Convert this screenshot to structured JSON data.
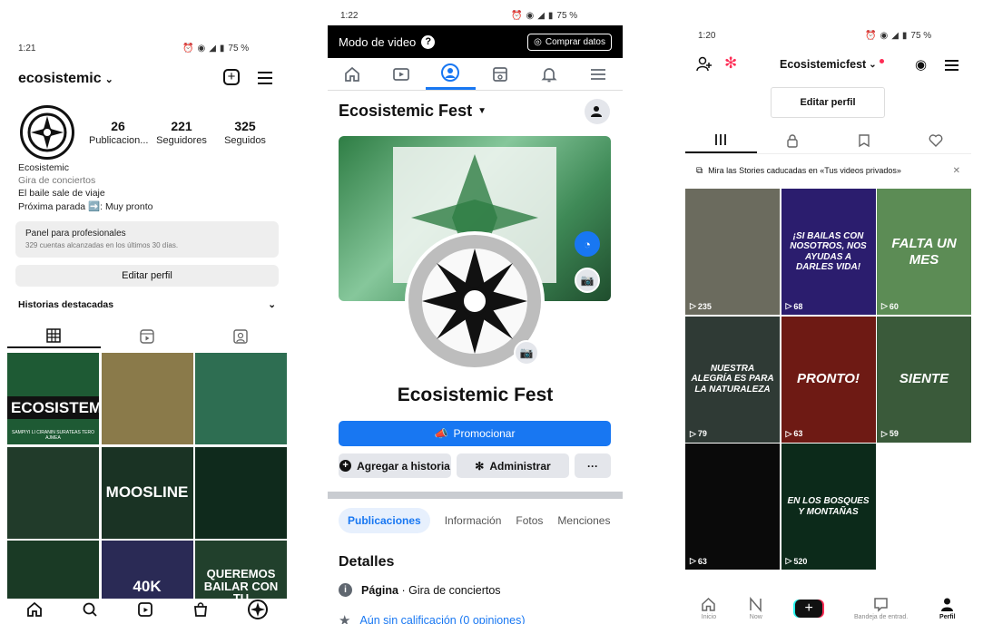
{
  "instagram": {
    "time": "1:21",
    "battery": "75 %",
    "username": "ecosistemic",
    "stats": [
      {
        "num": "26",
        "label": "Publicacion..."
      },
      {
        "num": "221",
        "label": "Seguidores"
      },
      {
        "num": "325",
        "label": "Seguidos"
      }
    ],
    "bio": {
      "name": "Ecosistemic",
      "category": "Gira de conciertos",
      "line1": "El baile sale de viaje",
      "line2": "Próxima parada ➡️: Muy pronto"
    },
    "panel": {
      "title": "Panel para profesionales",
      "subtitle": "329 cuentas alcanzadas en los últimos 30 días."
    },
    "edit_label": "Editar perfil",
    "highlights_label": "Historias destacadas",
    "grid": [
      {
        "text": "ECOSISTEMIC",
        "sub": "SAMPIYI LI CIRANIN SURATEAS TERO AJMEA",
        "bg": "#1e5a34"
      },
      {
        "text": "",
        "sub": "",
        "bg": "#8a7a4a"
      },
      {
        "text": "",
        "sub": "",
        "bg": "#2e6e52"
      },
      {
        "text": "",
        "sub": "",
        "bg": "#213b2a"
      },
      {
        "text": "MOOSLINE",
        "sub": "",
        "bg": "#1a3324"
      },
      {
        "text": "",
        "sub": "",
        "bg": "#0f2a1c"
      },
      {
        "text": "",
        "sub": "",
        "bg": "#1a3a25"
      },
      {
        "text": "40K",
        "sub": "",
        "bg": "#2a2a55"
      },
      {
        "text": "QUEREMOS BAILAR CON TU",
        "sub": "",
        "bg": "#21402c"
      }
    ]
  },
  "facebook": {
    "time": "1:22",
    "battery": "75 %",
    "video_mode": "Modo de video",
    "buy_data": "Comprar datos",
    "page_name": "Ecosistemic Fest",
    "title": "Ecosistemic Fest",
    "promote": "Promocionar",
    "add_story": "Agregar a historia",
    "admin": "Administrar",
    "more": "···",
    "tabs": [
      "Publicaciones",
      "Información",
      "Fotos",
      "Menciones"
    ],
    "details_title": "Detalles",
    "page_label": "Página",
    "page_category": " · Gira de conciertos",
    "rating": "Aún sin calificación (0 opiniones)"
  },
  "tiktok": {
    "time": "1:20",
    "battery": "75 %",
    "username": "Ecosistemicfest",
    "edit_label": "Editar perfil",
    "notice": "Mira las Stories caducadas en «Tus videos privados»",
    "grid": [
      {
        "text": "",
        "views": "235",
        "bg": "#6b6b5e"
      },
      {
        "text": "¡SI BAILAS CON NOSOTROS, NOS AYUDAS A DARLES VIDA!",
        "views": "68",
        "bg": "#2b1d6e"
      },
      {
        "text": "FALTA UN MES",
        "views": "60",
        "bg": "#5c8c55"
      },
      {
        "text": "NUESTRA ALEGRÍA ES PARA LA NATURALEZA",
        "views": "79",
        "bg": "#2f3a35"
      },
      {
        "text": "PRONTO!",
        "views": "63",
        "bg": "#6e1a14"
      },
      {
        "text": "SIENTE",
        "views": "59",
        "bg": "#3a5a3a"
      },
      {
        "text": "",
        "views": "63",
        "bg": "#0a0a0a"
      },
      {
        "text": "EN LOS BOSQUES Y MONTAÑAS",
        "views": "520",
        "bg": "#0c2a1a"
      }
    ],
    "nav": [
      "Inicio",
      "Now",
      "",
      "Bandeja de entrad.",
      "Perfil"
    ]
  }
}
